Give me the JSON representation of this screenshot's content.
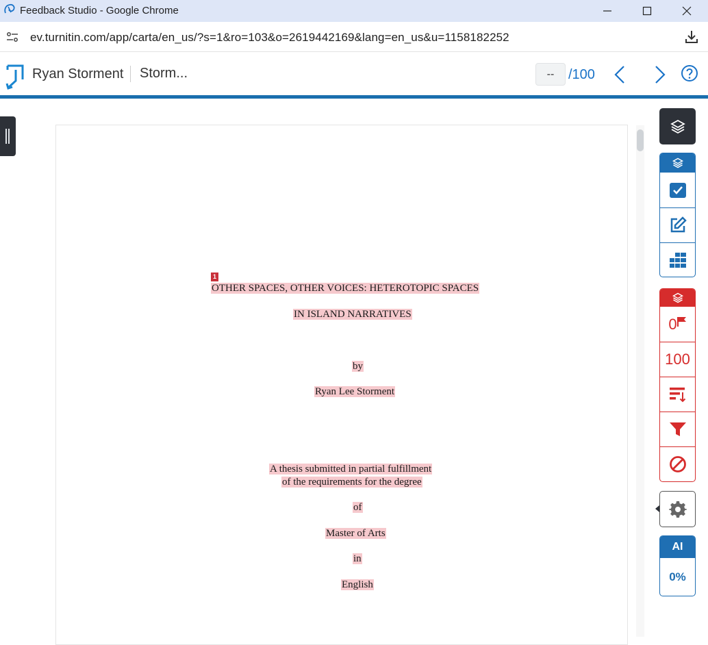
{
  "window": {
    "title": "Feedback Studio - Google Chrome"
  },
  "browser": {
    "url": "ev.turnitin.com/app/carta/en_us/?s=1&ro=103&o=2619442169&lang=en_us&u=1158182252"
  },
  "header": {
    "student_name": "Ryan Storment",
    "doc_title": "Storm...",
    "grade_value": "--",
    "grade_max": "/100"
  },
  "document": {
    "match_number": "1",
    "lines": [
      "OTHER SPACES, OTHER VOICES: HETEROTOPIC SPACES",
      "IN ISLAND NARRATIVES",
      "by",
      "Ryan Lee Storment",
      "A thesis submitted in partial fulfillment",
      "of the requirements for the degree",
      "of",
      "Master of Arts",
      "in",
      "English"
    ]
  },
  "right_panel": {
    "flag_count": "0",
    "similarity_score": "100",
    "ai_label": "AI",
    "ai_value": "0%"
  },
  "colors": {
    "brand_blue": "#1f6fb3",
    "similarity_red": "#d62c2c",
    "highlight": "#f6c9cd",
    "dark": "#2d3138"
  }
}
